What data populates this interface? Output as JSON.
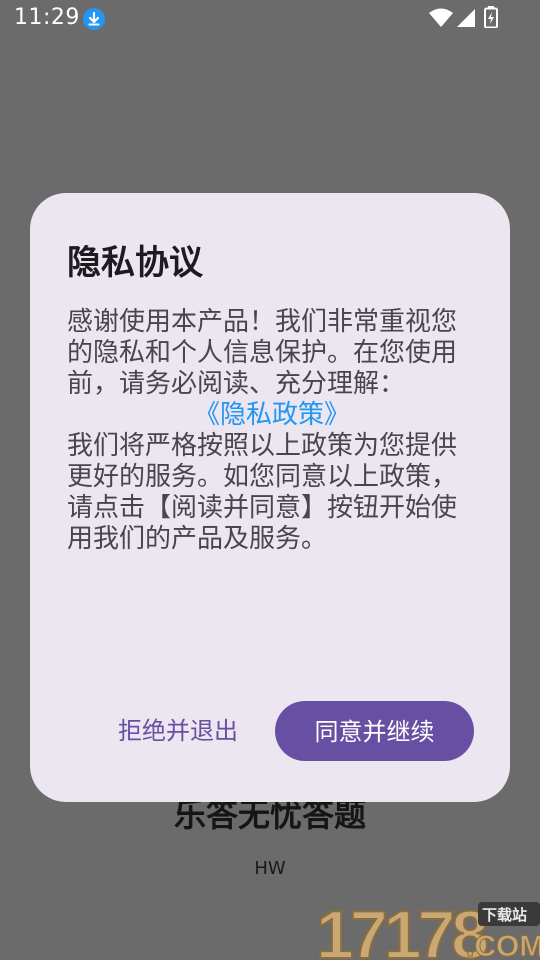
{
  "status_bar": {
    "time": "11:29",
    "icons": [
      "download-icon",
      "wifi-icon",
      "signal-icon",
      "battery-icon"
    ]
  },
  "background_app": {
    "title": "乐答无忧答题",
    "subtitle": "HW"
  },
  "watermark": {
    "number": "17178",
    "tag": "下载站",
    "suffix": ".COM"
  },
  "dialog": {
    "title": "隐私协议",
    "body_intro": "感谢使用本产品！我们非常重视您的隐私和个人信息保护。在您使用前，请务必阅读、充分理解：",
    "policy_link": "《隐私政策》",
    "body_outro": "我们将严格按照以上政策为您提供更好的服务。如您同意以上政策，请点击【阅读并同意】按钮开始使用我们的产品及服务。",
    "decline_label": "拒绝并退出",
    "accept_label": "同意并继续"
  },
  "colors": {
    "scrim": "#6b6b6b",
    "dialog_bg": "#ece6f0",
    "primary": "#6750a4",
    "link": "#2196f3"
  }
}
